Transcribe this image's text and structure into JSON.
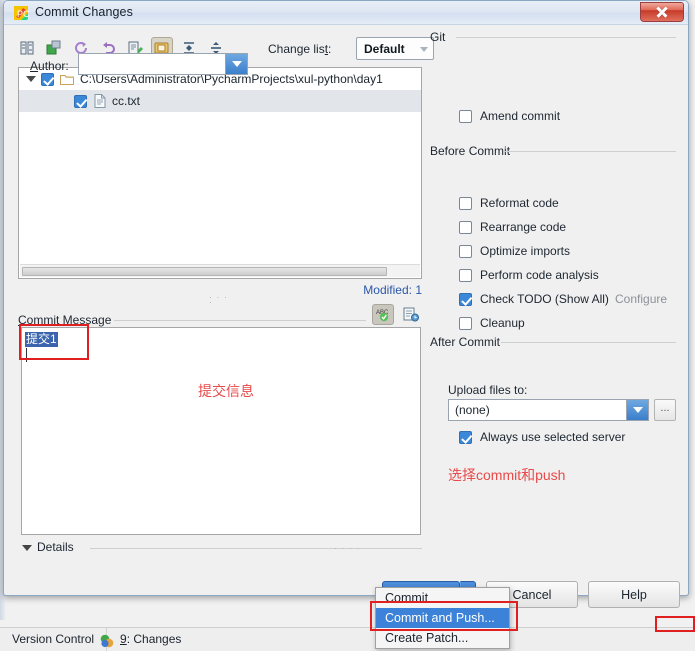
{
  "window": {
    "title": "Commit Changes",
    "app_icon": "pycharm-icon",
    "close_label": "Close"
  },
  "toolbar": {
    "icons": [
      {
        "name": "show-diff-icon",
        "tip": "Show Diff"
      },
      {
        "name": "move-to-changelist-icon",
        "tip": "Move to Another Changelist"
      },
      {
        "name": "refresh-icon",
        "tip": "Refresh"
      },
      {
        "name": "rollback-icon",
        "tip": "Revert"
      },
      {
        "name": "edit-source-icon",
        "tip": "Edit Source"
      },
      {
        "name": "group-by-directory-icon",
        "tip": "Group by Directory",
        "pressed": true
      },
      {
        "name": "expand-all-icon",
        "tip": "Expand All"
      },
      {
        "name": "collapse-all-icon",
        "tip": "Collapse All"
      }
    ],
    "changelist_label_pre": "Change lis",
    "changelist_label_mnemonic": "t",
    "changelist_label_post": ":",
    "changelist_value": "Default"
  },
  "tree": {
    "root_path": "C:\\Users\\Administrator\\PycharmProjects\\xul-python\\day1",
    "root_checked": true,
    "expanded": true,
    "children": [
      {
        "name": "cc.txt",
        "checked": true,
        "icon": "text-file-icon",
        "selected": true
      }
    ],
    "modified_count_label": "Modified: 1"
  },
  "commit_message": {
    "label_mnemonic": "C",
    "label_rest": "ommit Message",
    "value": "提交1",
    "selected": true,
    "spellcheck_icon": "abc-spellcheck-icon",
    "history_icon": "message-history-icon"
  },
  "details": {
    "label": "Details",
    "expanded": true
  },
  "git": {
    "group_label": "Git",
    "author_label_mnemonic": "A",
    "author_label_rest": "uthor:",
    "author_value": "",
    "amend_commit": {
      "label_pre": "A",
      "label_mnemonic": "m",
      "label_post": "end commit",
      "label": "Amend commit",
      "checked": false
    }
  },
  "before_commit": {
    "group_label": "Before Commit",
    "items": [
      {
        "label": "Reformat code",
        "checked": false,
        "name": "reformat-code"
      },
      {
        "label": "Rearrange code",
        "checked": false,
        "name": "rearrange-code"
      },
      {
        "label": "Optimize imports",
        "checked": false,
        "name": "optimize-imports"
      },
      {
        "label": "Perform code analysis",
        "checked": false,
        "name": "perform-code-analysis"
      },
      {
        "label": "Check TODO (Show All)",
        "checked": true,
        "name": "check-todo"
      },
      {
        "label": "Cleanup",
        "checked": false,
        "name": "cleanup"
      }
    ],
    "configure_link": "Configure"
  },
  "after_commit": {
    "group_label": "After Commit",
    "upload_label": "Upload files to:",
    "upload_value": "(none)",
    "browse_label": "...",
    "always_use_server": {
      "label": "Always use selected server",
      "checked": true
    }
  },
  "buttons": {
    "commit": "Commit",
    "cancel": "Cancel",
    "help": "Help"
  },
  "dropdown": {
    "items": [
      {
        "label": "Commit",
        "highlighted": false,
        "name": "menu-commit"
      },
      {
        "label": "Commit and Push...",
        "highlighted": true,
        "name": "menu-commit-and-push"
      },
      {
        "label": "Create Patch...",
        "highlighted": false,
        "name": "menu-create-patch"
      }
    ]
  },
  "statusbar": {
    "version_control": "Version Control",
    "changes_number": "9",
    "changes_label": ": Changes"
  },
  "annotations": [
    {
      "name": "annotation-commit-message",
      "text": "提交信息",
      "color": "#e84a4a"
    },
    {
      "name": "annotation-commit-push",
      "text": "选择commit和push",
      "color": "#e84a4a"
    }
  ],
  "colors": {
    "accent_blue": "#3b82d8",
    "annotation_red": "#e02020",
    "link_gray": "#8c9099",
    "modified_blue": "#2b57a8"
  }
}
